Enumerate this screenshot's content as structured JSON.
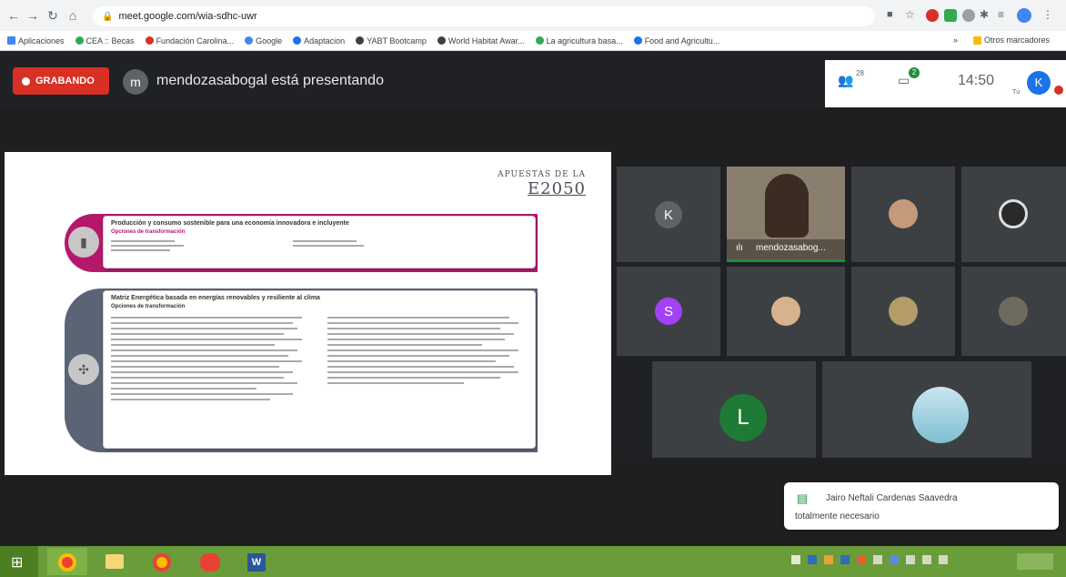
{
  "browser": {
    "url": "meet.google.com/wia-sdhc-uwr",
    "bookmarks": [
      "Aplicaciones",
      "CEA :: Becas",
      "Fundación Carolina...",
      "Google",
      "Adaptacion",
      "YABT Bootcamp",
      "World Habitat Awar...",
      "La agricultura basa...",
      "Food and Agricultu..."
    ],
    "other_bookmarks": "Otros marcadores"
  },
  "meet": {
    "recording_label": "GRABANDO",
    "presenter_initial": "m",
    "presenting_text": "mendozasabogal está presentando",
    "time": "14:50",
    "participant_count": "28",
    "chat_badge": "2",
    "you_label": "Tú",
    "user_initial": "K"
  },
  "slide": {
    "header_line1": "APUESTAS DE LA",
    "header_line2": "E2050",
    "section1": {
      "title": "Producción y consumo sostenible para una economía innovadora e incluyente",
      "subtitle": "Opciones de transformación"
    },
    "section2": {
      "title": "Matriz Energética basada en energías renovables y resiliente al clima",
      "subtitle": "Opciones de transformación"
    }
  },
  "participants": {
    "tile1_initial": "K",
    "featured_name": "mendozasabog...",
    "tile_s_initial": "S",
    "tile_l_initial": "L"
  },
  "chat": {
    "sender": "Jairo Neftali Cardenas Saavedra",
    "message": "totalmente necesario"
  },
  "colors": {
    "recording": "#d93025",
    "accent_magenta": "#b5186b",
    "accent_slate": "#5b6475",
    "avatar_purple": "#a142f4",
    "avatar_green": "#34a853",
    "avatar_grey": "#5f6368"
  }
}
